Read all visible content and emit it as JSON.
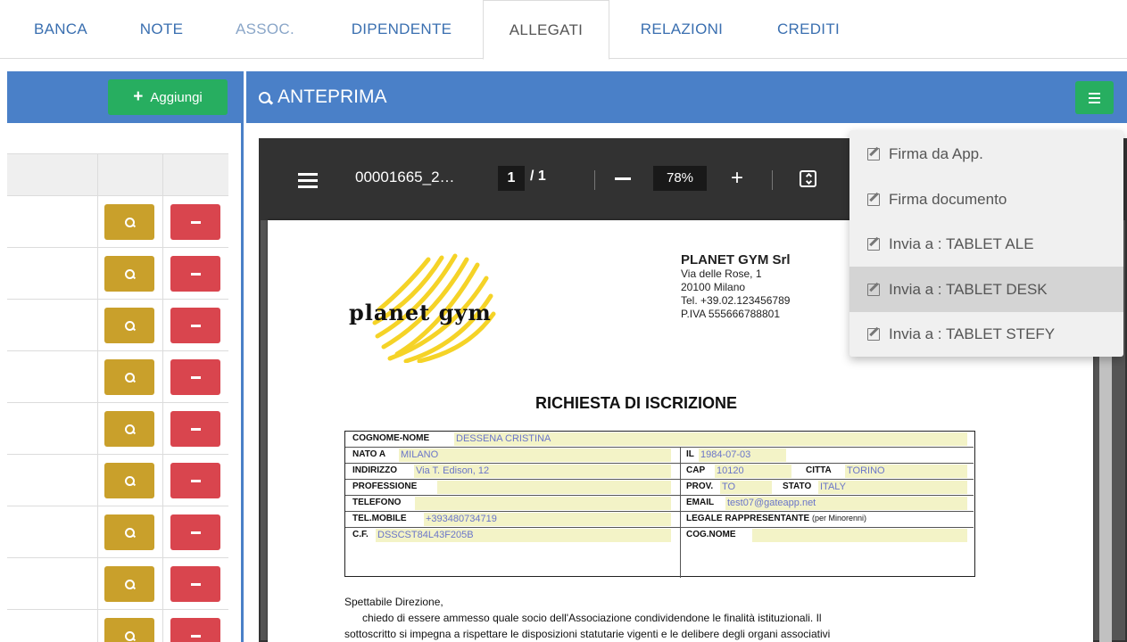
{
  "tabs": [
    {
      "label": "BANCA"
    },
    {
      "label": "NOTE"
    },
    {
      "label": "ASSOC."
    },
    {
      "label": "DIPENDENTE"
    },
    {
      "label": "ALLEGATI"
    },
    {
      "label": "RELAZIONI"
    },
    {
      "label": "CREDITI"
    }
  ],
  "left_panel": {
    "add_label": "Aggiungi"
  },
  "right_panel": {
    "title": "ANTEPRIMA"
  },
  "pdf_toolbar": {
    "filename": "00001665_2…",
    "page_current": "1",
    "page_total": "/ 1",
    "zoom": "78%"
  },
  "document": {
    "company_name": "PLANET GYM Srl",
    "address": "Via delle Rose, 1",
    "city": "20100 Milano",
    "phone": "Tel. +39.02.123456789",
    "vat": "P.IVA 555666788801",
    "title": "RICHIESTA DI ISCRIZIONE",
    "form": {
      "cognome_nome_label": "COGNOME-NOME",
      "cognome_nome": "DESSENA CRISTINA",
      "nato_a_label": "NATO A",
      "nato_a": "MILANO",
      "il_label": "IL",
      "il": "1984-07-03",
      "indirizzo_label": "INDIRIZZO",
      "indirizzo": "Via T. Edison, 12",
      "cap_label": "CAP",
      "cap": "10120",
      "citta_label": "CITTA",
      "citta": "TORINO",
      "professione_label": "PROFESSIONE",
      "prov_label": "PROV.",
      "prov": "TO",
      "stato_label": "STATO",
      "stato": "ITALY",
      "telefono_label": "TELEFONO",
      "email_label": "EMAIL",
      "email": "test07@gateapp.net",
      "telmobile_label": "TEL.MOBILE",
      "telmobile": "+393480734719",
      "legale_label": "LEGALE RAPPRESENTANTE",
      "legale_note": "(per Minorenni)",
      "cf_label": "C.F.",
      "cf": "DSSCST84L43F205B",
      "cognome_label": "COG.NOME"
    },
    "salutation": "Spettabile Direzione,",
    "paragraph_line1": "chiedo di essere ammesso quale socio dell'Associazione condividendone le finalità istituzionali. Il",
    "paragraph_line2": "sottoscritto si impegna a rispettare le disposizioni statutarie vigenti e le delibere degli organi associativi"
  },
  "dropdown": {
    "items": [
      {
        "label": "Firma da App."
      },
      {
        "label": "Firma documento"
      },
      {
        "label": "Invia a : TABLET ALE"
      },
      {
        "label": "Invia a : TABLET DESK"
      },
      {
        "label": "Invia a : TABLET STEFY"
      }
    ]
  },
  "colors": {
    "header_blue": "#4a80c8",
    "green": "#27ae60",
    "gold": "#c9a02b",
    "red": "#d9454e"
  }
}
